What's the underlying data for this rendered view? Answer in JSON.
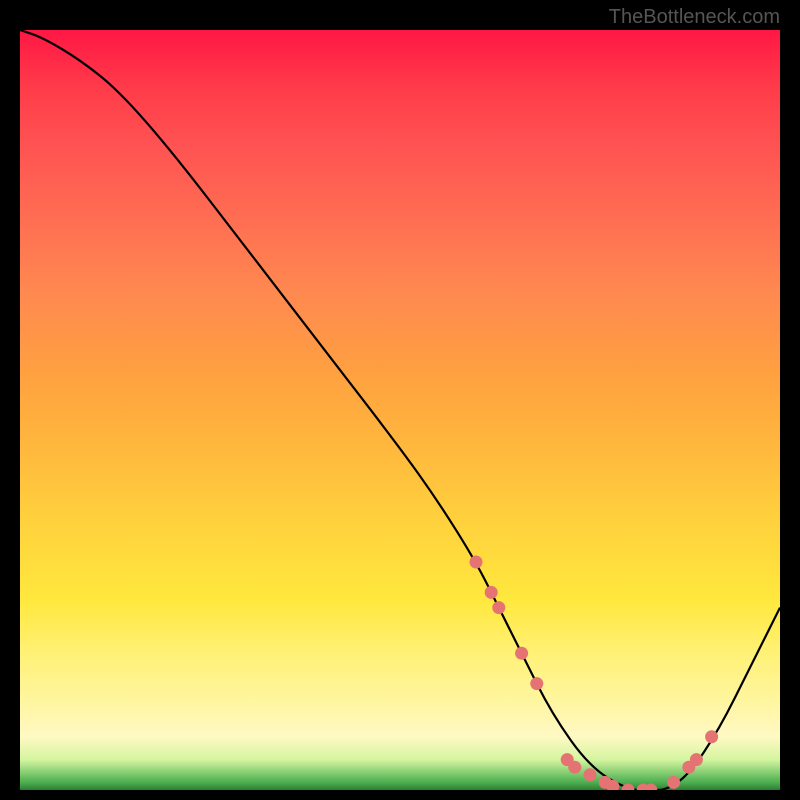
{
  "attribution": "TheBottleneck.com",
  "chart_data": {
    "type": "line",
    "title": "",
    "xlabel": "",
    "ylabel": "",
    "xlim": [
      0,
      100
    ],
    "ylim": [
      0,
      100
    ],
    "series": [
      {
        "name": "bottleneck-curve",
        "x": [
          0,
          3,
          8,
          13,
          20,
          30,
          40,
          50,
          55,
          60,
          63,
          66,
          70,
          75,
          80,
          83,
          85,
          88,
          92,
          96,
          100
        ],
        "y": [
          100,
          99,
          96,
          92,
          84,
          71,
          58,
          45,
          38,
          30,
          24,
          18,
          10,
          3,
          0,
          0,
          0,
          2,
          8,
          16,
          24
        ],
        "color": "#000000"
      }
    ],
    "markers": {
      "name": "highlight-dots",
      "color": "#e57373",
      "points": [
        {
          "x": 60,
          "y": 30
        },
        {
          "x": 62,
          "y": 26
        },
        {
          "x": 63,
          "y": 24
        },
        {
          "x": 66,
          "y": 18
        },
        {
          "x": 68,
          "y": 14
        },
        {
          "x": 72,
          "y": 4
        },
        {
          "x": 73,
          "y": 3
        },
        {
          "x": 75,
          "y": 2
        },
        {
          "x": 77,
          "y": 1
        },
        {
          "x": 78,
          "y": 0.5
        },
        {
          "x": 80,
          "y": 0
        },
        {
          "x": 82,
          "y": 0
        },
        {
          "x": 83,
          "y": 0
        },
        {
          "x": 86,
          "y": 1
        },
        {
          "x": 88,
          "y": 3
        },
        {
          "x": 89,
          "y": 4
        },
        {
          "x": 91,
          "y": 7
        }
      ]
    },
    "gradient_bands": [
      {
        "stop": 0,
        "color": "#ff1744",
        "meaning": "high-bottleneck"
      },
      {
        "stop": 50,
        "color": "#ffc107",
        "meaning": "medium-bottleneck"
      },
      {
        "stop": 95,
        "color": "#fff59d",
        "meaning": "low-bottleneck"
      },
      {
        "stop": 100,
        "color": "#2e7d32",
        "meaning": "optimal"
      }
    ]
  }
}
